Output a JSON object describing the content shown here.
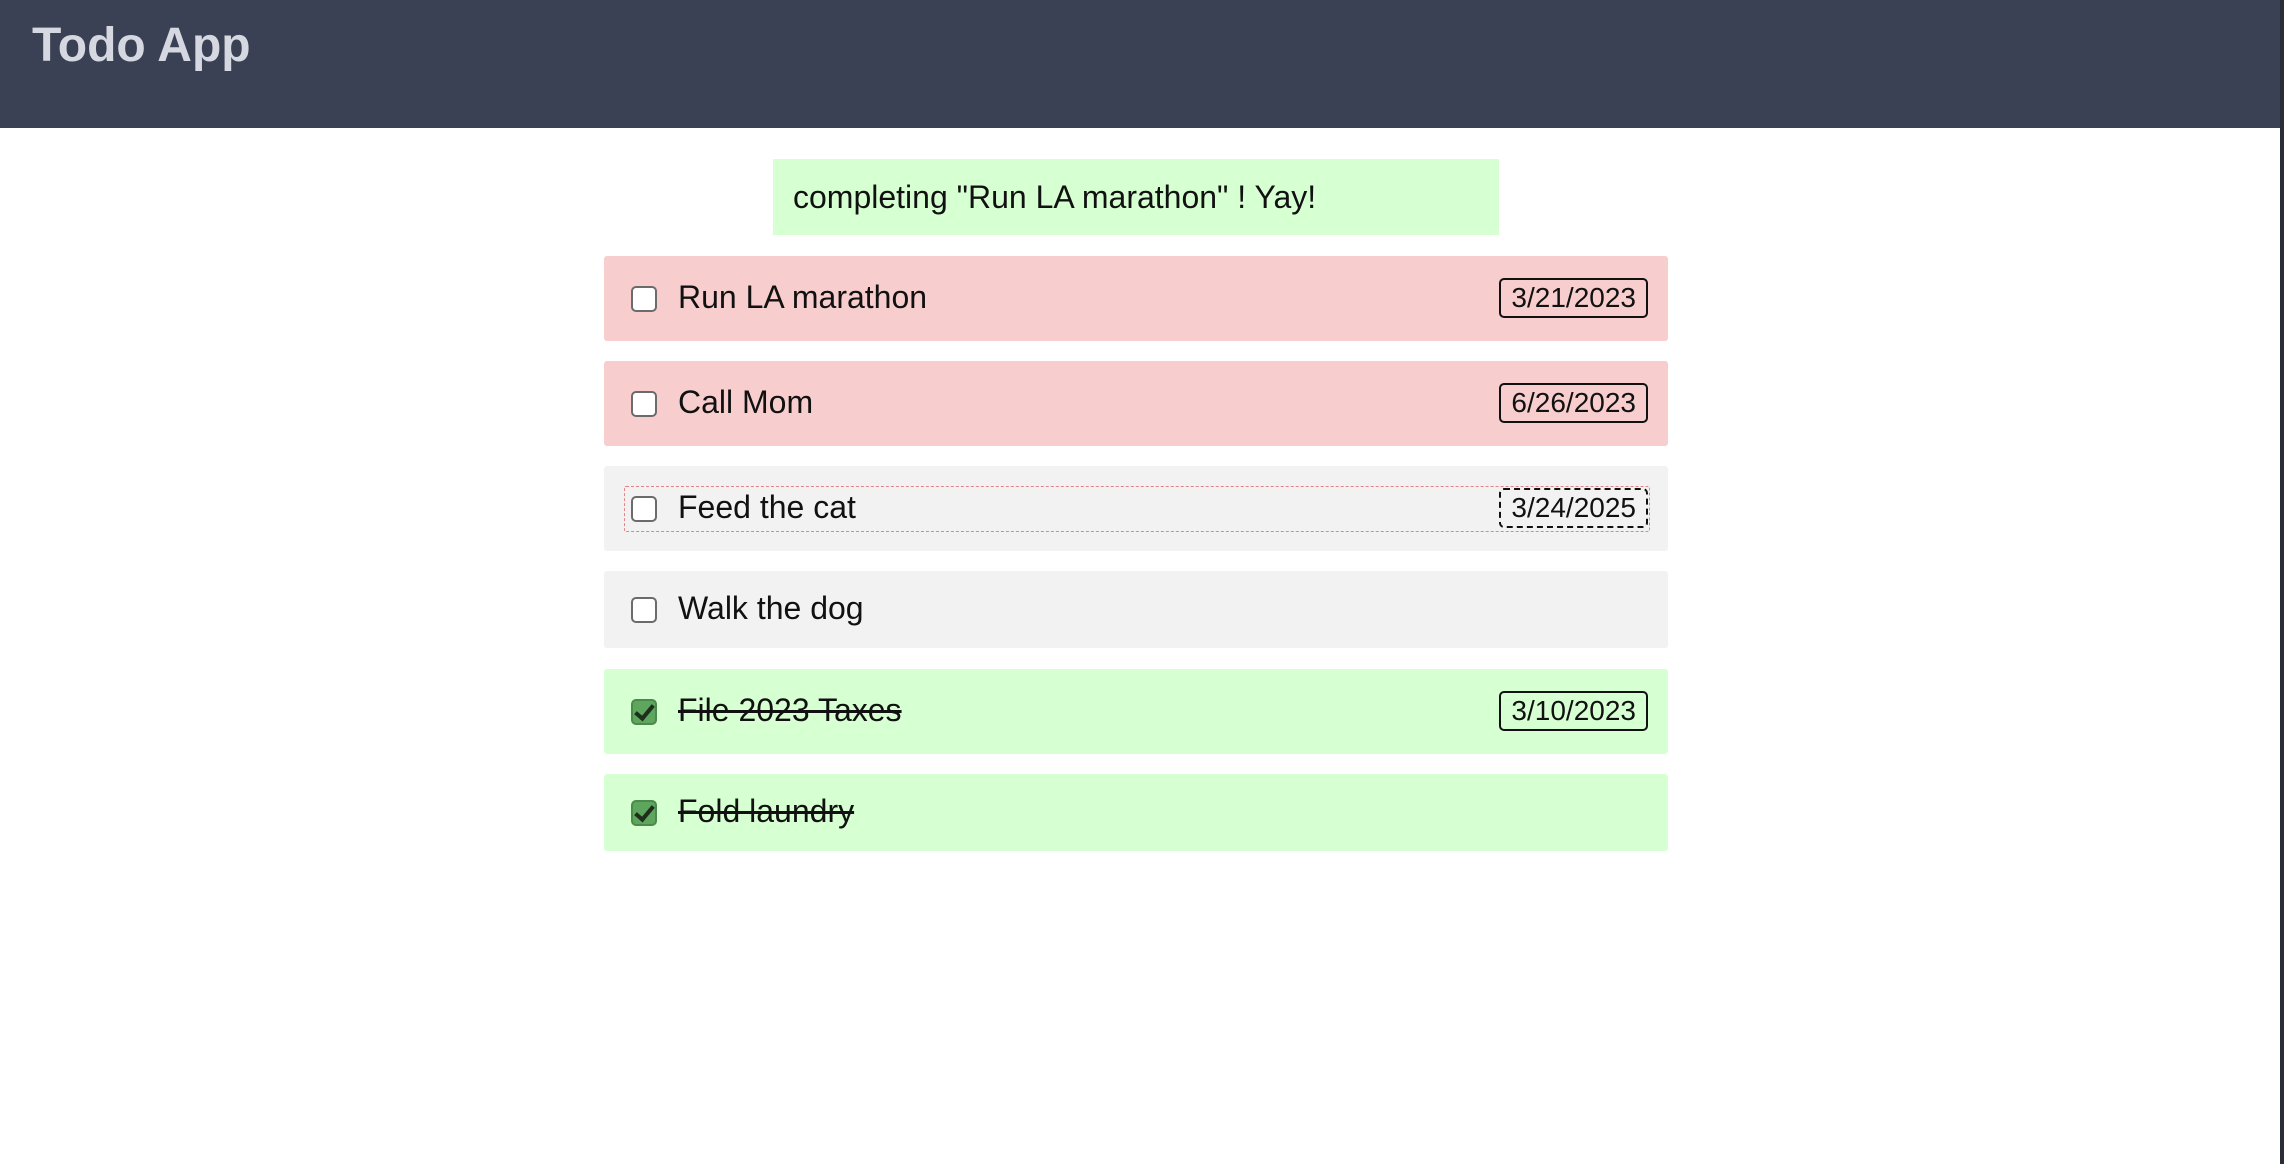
{
  "header": {
    "title": "Todo App"
  },
  "banner": {
    "message": "completing \"Run LA marathon\" ! Yay!"
  },
  "todos": [
    {
      "label": "Run LA marathon",
      "date": "3/21/2023",
      "completed": false,
      "status": "overdue"
    },
    {
      "label": "Call Mom",
      "date": "6/26/2023",
      "completed": false,
      "status": "overdue"
    },
    {
      "label": "Feed the cat",
      "date": "3/24/2025",
      "completed": false,
      "status": "pending"
    },
    {
      "label": "Walk the dog",
      "date": "",
      "completed": false,
      "status": "pending"
    },
    {
      "label": "File 2023 Taxes",
      "date": "3/10/2023",
      "completed": true,
      "status": "done"
    },
    {
      "label": "Fold laundry",
      "date": "",
      "completed": true,
      "status": "done"
    }
  ],
  "colors": {
    "header_bg": "#3b4154",
    "overdue_bg": "#f8cdcd",
    "pending_bg": "#f2f2f2",
    "done_bg": "#d6ffd2",
    "check_green": "#5ea55e"
  },
  "icons": {
    "checked": "checkmark-icon"
  }
}
